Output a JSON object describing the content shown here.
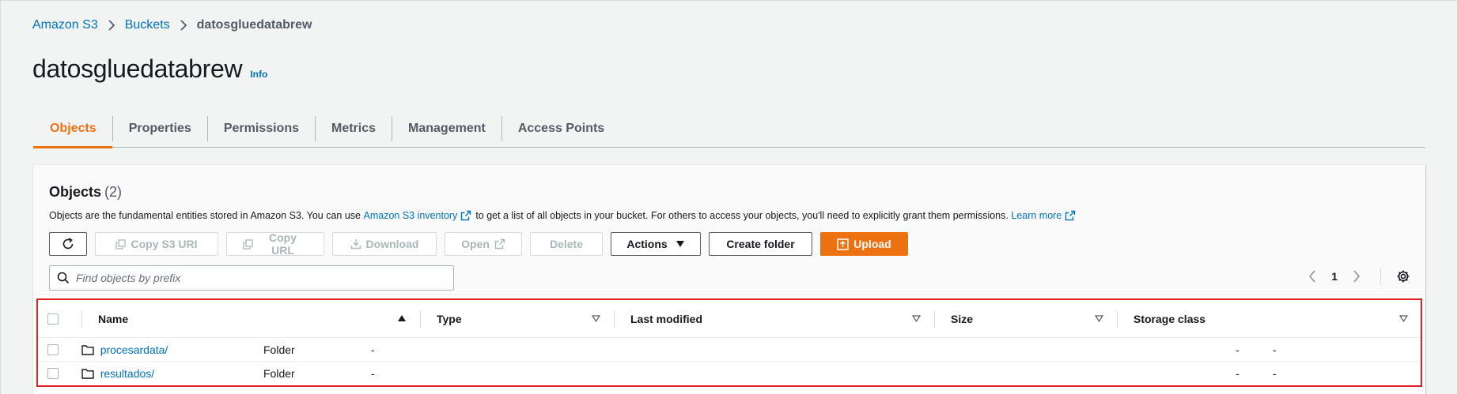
{
  "breadcrumb": {
    "items": [
      "Amazon S3",
      "Buckets"
    ],
    "current": "datosgluedatabrew"
  },
  "page": {
    "title": "datosgluedatabrew",
    "info": "Info"
  },
  "tabs": [
    "Objects",
    "Properties",
    "Permissions",
    "Metrics",
    "Management",
    "Access Points"
  ],
  "active_tab": "Objects",
  "panel": {
    "title": "Objects",
    "count": "(2)",
    "desc_pre": "Objects are the fundamental entities stored in Amazon S3. You can use",
    "desc_link": "Amazon S3 inventory",
    "desc_mid": "to get a list of all objects in your bucket. For others to access your objects, you'll need to explicitly grant them permissions.",
    "learn_more": "Learn more"
  },
  "toolbar": {
    "copy_s3_uri": "Copy S3 URI",
    "copy_url": "Copy URL",
    "download": "Download",
    "open": "Open",
    "delete": "Delete",
    "actions": "Actions",
    "create_folder": "Create folder",
    "upload": "Upload"
  },
  "search": {
    "placeholder": "Find objects by prefix",
    "value": ""
  },
  "pagination": {
    "current_page": "1"
  },
  "table": {
    "columns": [
      "Name",
      "Type",
      "Last modified",
      "Size",
      "Storage class"
    ],
    "rows": [
      {
        "name": "procesardata/",
        "type": "Folder",
        "last_modified": "-",
        "size": "-",
        "storage_class": "-"
      },
      {
        "name": "resultados/",
        "type": "Folder",
        "last_modified": "-",
        "size": "-",
        "storage_class": "-"
      }
    ]
  },
  "colors": {
    "link": "#0073bb",
    "accent": "#ec7211",
    "highlight_border": "#e02020"
  }
}
